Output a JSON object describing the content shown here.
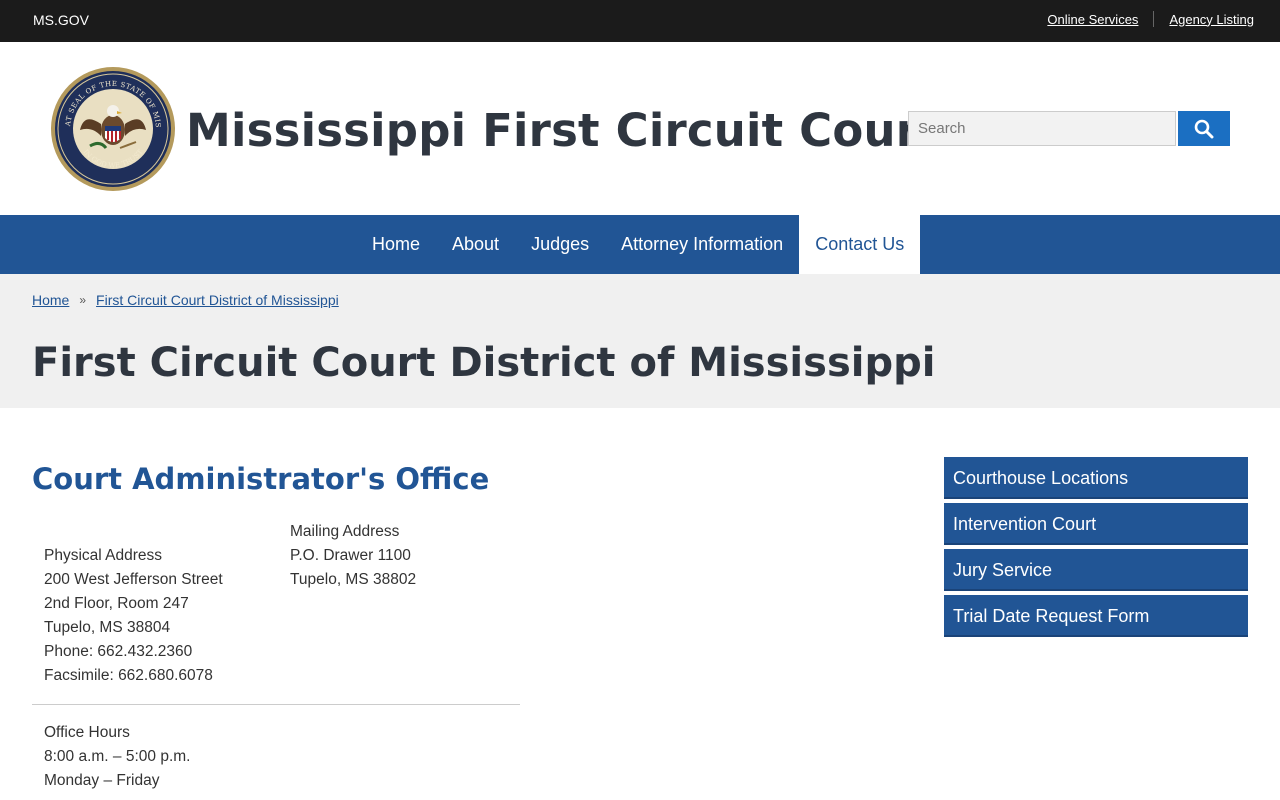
{
  "topbar": {
    "brand": "MS.GOV",
    "links": [
      "Online Services",
      "Agency Listing"
    ]
  },
  "header": {
    "site_title": "Mississippi First Circuit Court",
    "seal": {
      "text": "THE GREAT SEAL OF THE STATE OF MISSISSIPPI",
      "motto": "IN GOD WE TRUST"
    },
    "search": {
      "placeholder": "Search"
    }
  },
  "nav": {
    "items": [
      "Home",
      "About",
      "Judges",
      "Attorney Information",
      "Contact Us"
    ],
    "active": "Contact Us"
  },
  "breadcrumb": {
    "items": [
      "Home",
      "First Circuit Court District of Mississippi"
    ],
    "separator": "»"
  },
  "page": {
    "title": "First Circuit Court District of Mississippi"
  },
  "content": {
    "section_title": "Court Administrator's Office",
    "physical": {
      "heading": "Physical Address",
      "line1": "200 West Jefferson Street",
      "line2": "2nd Floor, Room 247",
      "line3": "Tupelo, MS 38804",
      "phone": "Phone:  662.432.2360",
      "fax": "Facsimile:  662.680.6078"
    },
    "mailing": {
      "heading": "Mailing Address",
      "line1": "P.O. Drawer 1100",
      "line2": "Tupelo, MS 38802"
    },
    "hours": {
      "heading": "Office Hours",
      "time": "8:00 a.m. – 5:00 p.m.",
      "days": "Monday – Friday"
    }
  },
  "sidebar": {
    "links": [
      "Courthouse Locations",
      "Intervention Court",
      "Jury Service",
      "Trial Date Request Form"
    ]
  },
  "colors": {
    "nav_blue": "#215595",
    "search_blue": "#1b6fc2",
    "topbar": "#1b1b1b",
    "band": "#f0f0f0"
  }
}
